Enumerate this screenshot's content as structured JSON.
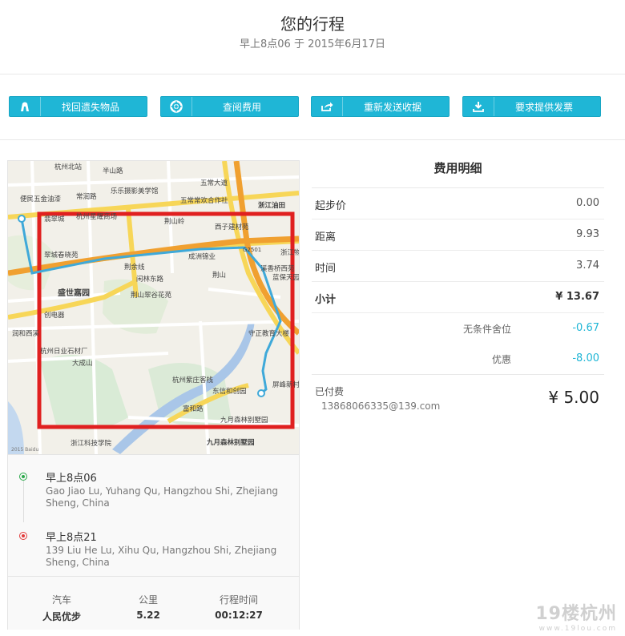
{
  "header": {
    "title": "您的行程",
    "subtitle": "早上8点06 于 2015年6月17日"
  },
  "actions": [
    {
      "label": "找回遗失物品",
      "icon": "lost-item-icon"
    },
    {
      "label": "查阅费用",
      "icon": "lifebuoy-icon"
    },
    {
      "label": "重新发送收据",
      "icon": "share-icon"
    },
    {
      "label": "要求提供发票",
      "icon": "download-icon"
    }
  ],
  "map": {
    "labels": [
      "杭州北站",
      "半山路",
      "五常大道",
      "乐乐摄影美学馆",
      "五常常欢合作社",
      "浙江油田",
      "常润路",
      "便民五金油漆",
      "杭州星耀商场",
      "翡翠城",
      "荆山岭",
      "翠城春晓苑",
      "西子建材苑",
      "盛世嘉园",
      "G2501",
      "浙江物流",
      "成洲锦业",
      "溪香桥西苑",
      "闲林东路",
      "荆山",
      "荆山翠谷花苑",
      "蓝保天园",
      "荆余线",
      "创电器",
      "润和西溪",
      "守正教育大楼",
      "杭州日业石材厂",
      "大成山",
      "杭州紫庄客栈",
      "东信和创园",
      "屏峰新村",
      "富和路",
      "九月森林别墅园",
      "浙江科技学院",
      "九月森林别墅园",
      "2015 Baidu"
    ],
    "route_color": "#3fa9d9",
    "highlight_color": "#e02020"
  },
  "trip": {
    "pickup": {
      "time": "早上8点06",
      "address": "Gao Jiao Lu, Yuhang Qu, Hangzhou Shi, Zhejiang Sheng, China"
    },
    "dropoff": {
      "time": "早上8点21",
      "address": "139 Liu He Lu, Xihu Qu, Hangzhou Shi, Zhejiang Sheng, China"
    },
    "stats": [
      {
        "label": "汽车",
        "value": "人民优步"
      },
      {
        "label": "公里",
        "value": "5.22"
      },
      {
        "label": "行程时间",
        "value": "00:12:27"
      }
    ]
  },
  "fare": {
    "title": "费用明细",
    "rows": [
      {
        "name": "起步价",
        "value": "0.00"
      },
      {
        "name": "距离",
        "value": "9.93"
      },
      {
        "name": "时间",
        "value": "3.74"
      }
    ],
    "subtotal": {
      "name": "小计",
      "value": "¥ 13.67"
    },
    "adjustments": [
      {
        "name": "无条件舍位",
        "value": "-0.67"
      },
      {
        "name": "优惠",
        "value": "-8.00"
      }
    ],
    "paid": {
      "name": "已付费",
      "email": "13868066335@139.com",
      "value": "¥ 5.00"
    }
  },
  "watermark": {
    "text": "19楼杭州",
    "sub": "www.19lou.com"
  },
  "colors": {
    "accent": "#1fb6d6",
    "pickup": "#2aa84a",
    "dropoff": "#e23b3b"
  }
}
